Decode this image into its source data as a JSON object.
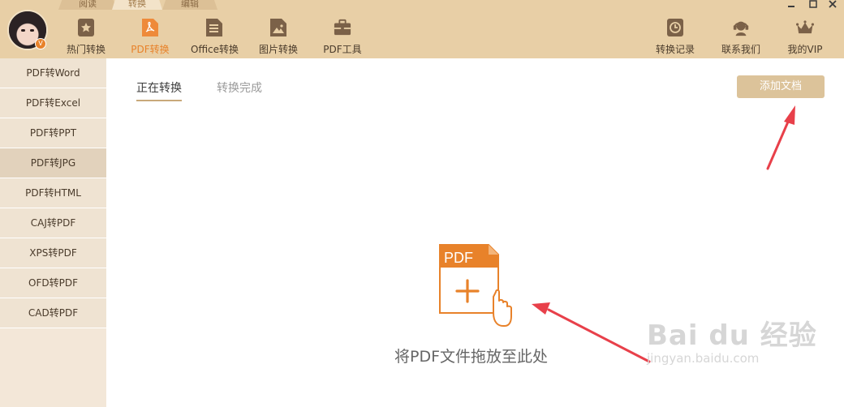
{
  "mode_tabs": [
    "阅读",
    "转换",
    "编辑"
  ],
  "toolbar": [
    {
      "label": "热门转换",
      "icon": "star-icon"
    },
    {
      "label": "PDF转换",
      "icon": "pdf-icon"
    },
    {
      "label": "Office转换",
      "icon": "document-icon"
    },
    {
      "label": "图片转换",
      "icon": "image-icon"
    },
    {
      "label": "PDF工具",
      "icon": "toolbox-icon"
    }
  ],
  "right_tools": [
    {
      "label": "转换记录",
      "icon": "history-icon"
    },
    {
      "label": "联系我们",
      "icon": "support-icon"
    },
    {
      "label": "我的VIP",
      "icon": "crown-icon"
    }
  ],
  "sidebar": [
    "PDF转Word",
    "PDF转Excel",
    "PDF转PPT",
    "PDF转JPG",
    "PDF转HTML",
    "CAJ转PDF",
    "XPS转PDF",
    "OFD转PDF",
    "CAD转PDF"
  ],
  "tabs": {
    "converting": "正在转换",
    "done": "转换完成"
  },
  "add_button": "添加文档",
  "drop_hint": "将PDF文件拖放至此处",
  "pdf_icon_label": "PDF",
  "watermark": {
    "brand": "Bai du 经验",
    "url": "jingyan.baidu.com"
  },
  "colors": {
    "accent": "#e8822a",
    "toolbar_bg": "#e8cfa6",
    "button_bg": "#dcc39a",
    "arrow": "#e8404a"
  }
}
